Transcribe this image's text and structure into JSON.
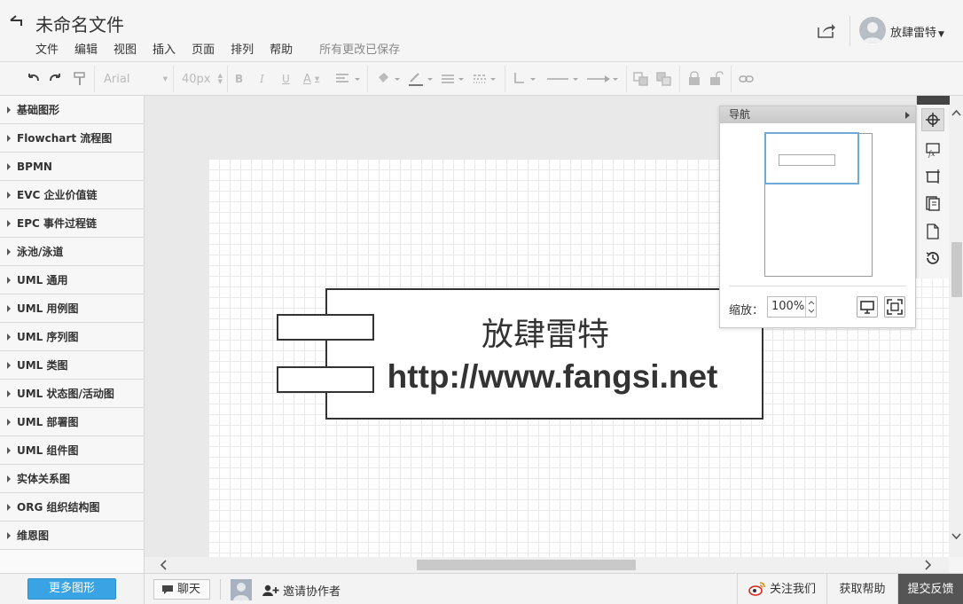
{
  "header": {
    "title": "未命名文件",
    "menu": [
      "文件",
      "编辑",
      "视图",
      "插入",
      "页面",
      "排列",
      "帮助"
    ],
    "save_status": "所有更改已保存",
    "user_name": "放肆雷特"
  },
  "toolbar": {
    "font_family": "Arial",
    "font_size": "40px"
  },
  "sidebar": {
    "categories": [
      "基础图形",
      "Flowchart 流程图",
      "BPMN",
      "EVC 企业价值链",
      "EPC 事件过程链",
      "泳池/泳道",
      "UML 通用",
      "UML 用例图",
      "UML 序列图",
      "UML 类图",
      "UML 状态图/活动图",
      "UML 部署图",
      "UML 组件图",
      "实体关系图",
      "ORG 组织结构图",
      "维恩图"
    ],
    "more_shapes": "更多图形"
  },
  "canvas": {
    "shape_line1": "放肆雷特",
    "shape_line2": "http://www.fangsi.net"
  },
  "navigator": {
    "title": "导航",
    "zoom_label": "缩放：",
    "zoom_value": "100%"
  },
  "footer": {
    "chat": "聊天",
    "invite": "邀请协作者",
    "follow": "关注我们",
    "help": "获取帮助",
    "feedback": "提交反馈"
  },
  "colors": {
    "accent": "#3aa3e3",
    "feedback_bg": "#555555",
    "navigator_view": "#6fa9d8"
  }
}
